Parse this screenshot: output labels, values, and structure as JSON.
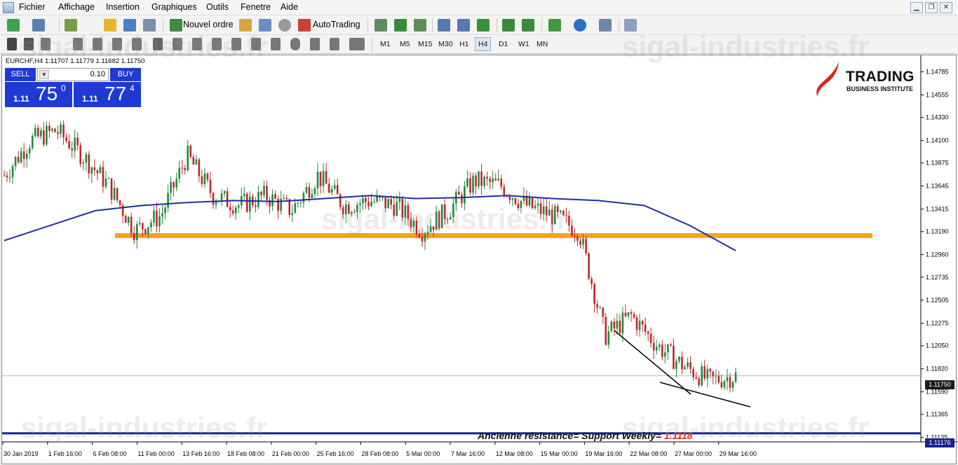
{
  "menu": {
    "items": [
      "Fichier",
      "Affichage",
      "Insertion",
      "Graphiques",
      "Outils",
      "Fenetre",
      "Aide"
    ]
  },
  "toolbar": {
    "new_order_label": "Nouvel ordre",
    "autotrading_label": "AutoTrading",
    "timeframes": [
      "M1",
      "M5",
      "M15",
      "M30",
      "H1",
      "H4",
      "D1",
      "W1",
      "MN"
    ],
    "active_timeframe": "H4"
  },
  "chart_header": {
    "symbol_info": "EURCHF,H4  1.11707 1.11779 1.11682 1.11750"
  },
  "trade_panel": {
    "sell_label": "SELL",
    "buy_label": "BUY",
    "lot_value": "0.10",
    "sell_prefix": "1.11",
    "sell_big": "75",
    "sell_sup": "0",
    "buy_prefix": "1.11",
    "buy_big": "77",
    "buy_sup": "4"
  },
  "logo": {
    "title": "TRADING",
    "subtitle": "BUSINESS INSTITUTE"
  },
  "watermark_text": "sigal-industries.fr",
  "annotation": {
    "prefix": "Ancienne résistance= Support Weekly= ",
    "level": "1.1118"
  },
  "price_tags": {
    "current": "1.11750",
    "support": "1.11176"
  },
  "chart_data": {
    "type": "candlestick",
    "symbol": "EURCHF",
    "timeframe": "H4",
    "y_ticks": [
      "1.14785",
      "1.14555",
      "1.14330",
      "1.14100",
      "1.13875",
      "1.13645",
      "1.13415",
      "1.13190",
      "1.12960",
      "1.12735",
      "1.12505",
      "1.12275",
      "1.12050",
      "1.11820",
      "1.11590",
      "1.11365",
      "1.11135"
    ],
    "ylim": [
      1.1109,
      1.1495
    ],
    "x_ticks": [
      "30 Jan 2019",
      "1 Feb 16:00",
      "6 Feb 08:00",
      "11 Feb 00:00",
      "13 Feb 16:00",
      "18 Feb 08:00",
      "21 Feb 00:00",
      "25 Feb 16:00",
      "28 Feb 08:00",
      "5 Mar 00:00",
      "7 Mar 16:00",
      "12 Mar 08:00",
      "15 Mar 00:00",
      "19 Mar 16:00",
      "22 Mar 08:00",
      "27 Mar 00:00",
      "29 Mar 16:00"
    ],
    "current_price": 1.1175,
    "support_level": 1.11176,
    "resistance_zone": 1.1315,
    "anchor_closes": [
      1.1375,
      1.141,
      1.142,
      1.1395,
      1.1365,
      1.132,
      1.1335,
      1.1395,
      1.1355,
      1.1345,
      1.1355,
      1.134,
      1.1375,
      1.1345,
      1.135,
      1.1345,
      1.132,
      1.134,
      1.137,
      1.1365,
      1.1345,
      1.1335,
      1.132,
      1.1215,
      1.1235,
      1.1205,
      1.1185,
      1.117,
      1.1175
    ],
    "moving_average": [
      1.131,
      1.1325,
      1.134,
      1.1345,
      1.1348,
      1.135,
      1.1349,
      1.1352,
      1.1355,
      1.1352,
      1.1353,
      1.1355,
      1.1352,
      1.135,
      1.1345,
      1.1325,
      1.13
    ],
    "colors": {
      "bull": "#1f8a3a",
      "bear": "#c0262a",
      "ma": "#1f2f9e",
      "zone": "#f6a21a",
      "trendline": "#000000"
    }
  }
}
